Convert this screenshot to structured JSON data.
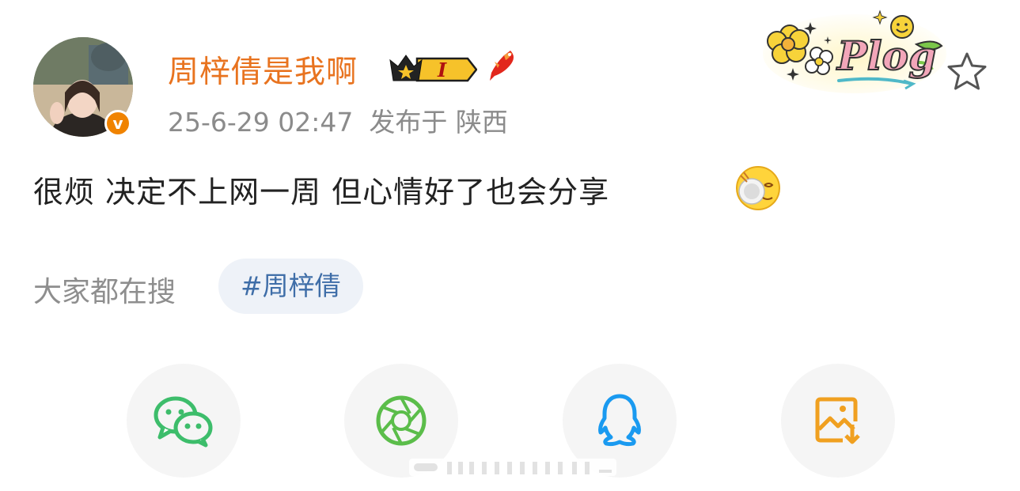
{
  "post": {
    "author": "周梓倩是我啊",
    "level_badge": "I",
    "verified_mark": "v",
    "date": "25-6-29 02:47",
    "location": "发布于 陕西",
    "text": "很烦 决定不上网一周 但心情好了也会分享",
    "sticker_text": "Plog"
  },
  "trending": {
    "label": "大家都在搜",
    "tag": "#周梓倩"
  },
  "share": [
    {
      "name": "wechat-icon",
      "color": "#3dbd6b"
    },
    {
      "name": "moments-icon",
      "color": "#5bbd4a"
    },
    {
      "name": "qq-icon",
      "color": "#1a9af0"
    },
    {
      "name": "save-image-icon",
      "color": "#f0a020"
    }
  ],
  "colors": {
    "username": "#e8731f",
    "tag_text": "#3f6ea8",
    "tag_bg": "#eef2f8"
  }
}
